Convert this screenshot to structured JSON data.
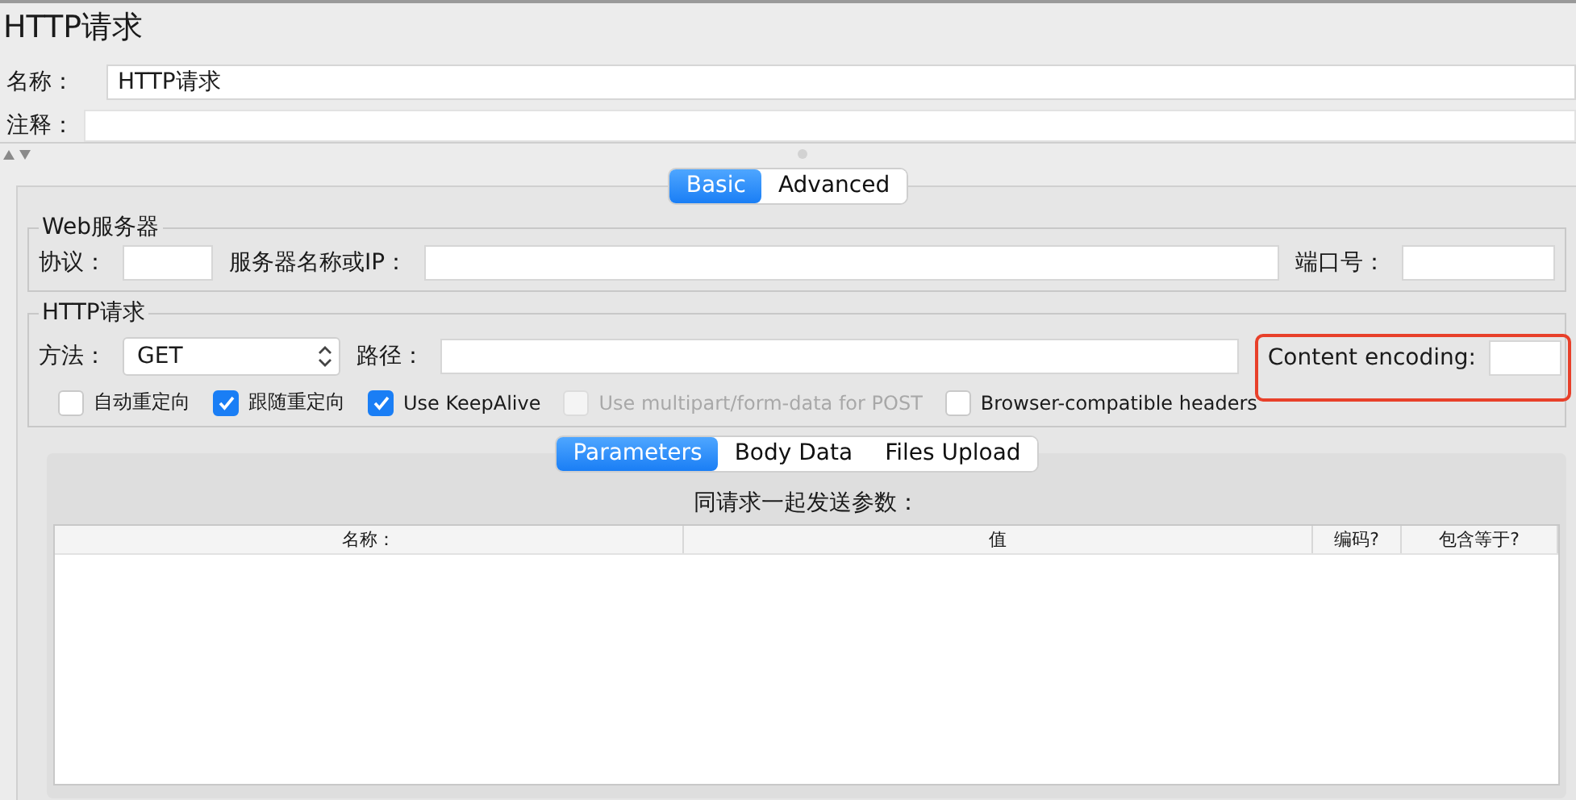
{
  "title": "HTTP请求",
  "name_field": {
    "label": "名称：",
    "value": "HTTP请求"
  },
  "comment_field": {
    "label": "注释："
  },
  "tabs": [
    {
      "label": "Basic",
      "selected": true
    },
    {
      "label": "Advanced",
      "selected": false
    }
  ],
  "web_server": {
    "title": "Web服务器",
    "protocol_label": "协议：",
    "server_label": "服务器名称或IP：",
    "port_label": "端口号："
  },
  "http_request": {
    "title": "HTTP请求",
    "method_label": "方法：",
    "method": "GET",
    "path_label": "路径：",
    "encoding_label": "Content encoding:",
    "encoding_highlighted": true,
    "options": [
      {
        "label": "自动重定向",
        "checked": false,
        "disabled": false
      },
      {
        "label": "跟随重定向",
        "checked": true,
        "disabled": false
      },
      {
        "label": "Use KeepAlive",
        "checked": true,
        "disabled": false
      },
      {
        "label": "Use multipart/form-data for POST",
        "checked": false,
        "disabled": true
      },
      {
        "label": "Browser-compatible headers",
        "checked": false,
        "disabled": false
      }
    ]
  },
  "body_tabs": [
    {
      "label": "Parameters",
      "selected": true
    },
    {
      "label": "Body Data",
      "selected": false
    },
    {
      "label": "Files Upload",
      "selected": false
    }
  ],
  "parameters": {
    "caption": "同请求一起发送参数：",
    "columns": [
      "名称：",
      "值",
      "编码?",
      "包含等于?"
    ]
  }
}
